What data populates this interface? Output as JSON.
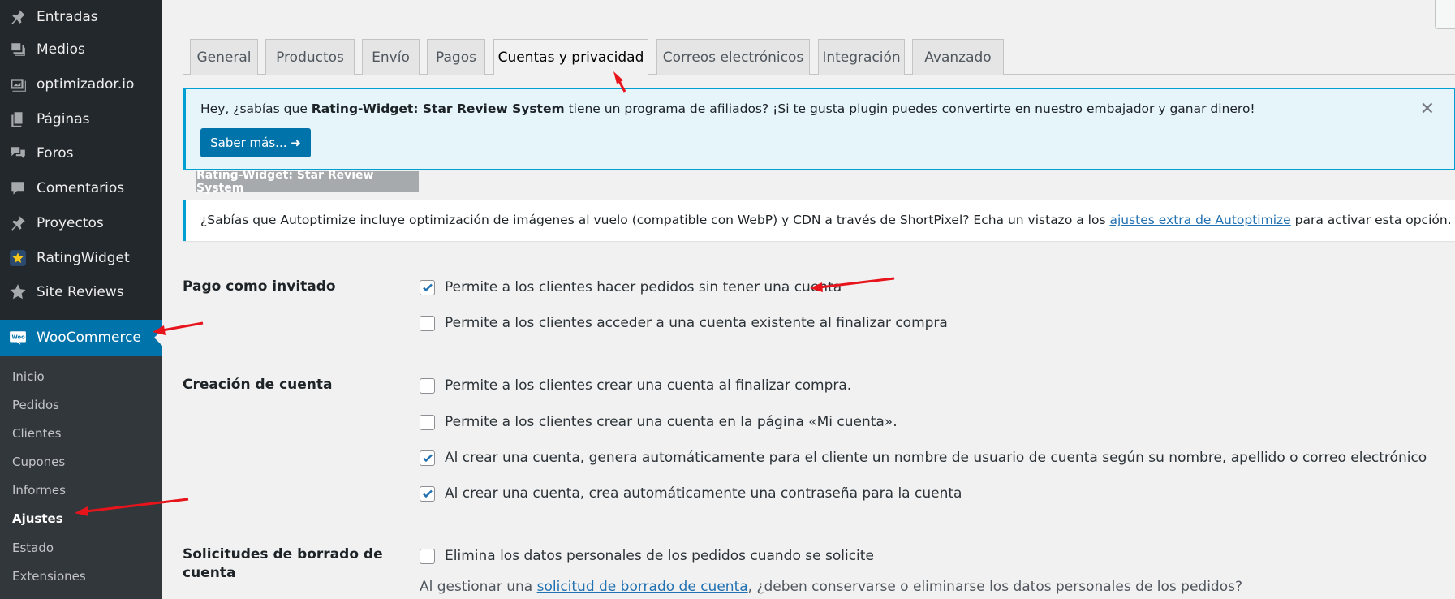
{
  "sidebar": {
    "items": [
      {
        "label": "Entradas",
        "icon": "pin-icon"
      },
      {
        "label": "Medios",
        "icon": "media-icon"
      },
      {
        "label": "optimizador.io",
        "icon": "optimizer-icon"
      },
      {
        "label": "Páginas",
        "icon": "pages-icon"
      },
      {
        "label": "Foros",
        "icon": "forums-icon"
      },
      {
        "label": "Comentarios",
        "icon": "comments-icon"
      },
      {
        "label": "Proyectos",
        "icon": "pin-icon"
      },
      {
        "label": "RatingWidget",
        "icon": "ratingwidget-icon"
      },
      {
        "label": "Site Reviews",
        "icon": "star-icon"
      }
    ],
    "woocommerce": {
      "label": "WooCommerce",
      "icon": "woo-icon"
    },
    "submenu": [
      "Inicio",
      "Pedidos",
      "Clientes",
      "Cupones",
      "Informes",
      "Ajustes",
      "Estado",
      "Extensiones"
    ],
    "submenu_current": "Ajustes"
  },
  "tabs": [
    "General",
    "Productos",
    "Envío",
    "Pagos",
    "Cuentas y privacidad",
    "Correos electrónicos",
    "Integración",
    "Avanzado"
  ],
  "active_tab": "Cuentas y privacidad",
  "affiliate_notice": {
    "text_before": "Hey, ¿sabías que ",
    "plugin_name": "Rating-Widget: Star Review System",
    "text_after": " tiene un programa de afiliados? ¡Si te gusta plugin puedes convertirte en nuestro embajador y ganar dinero!",
    "button_label": "Saber más... ➜",
    "close_label": "✕",
    "tag_label": "Rating-Widget: Star Review System"
  },
  "ao_notice": {
    "text_before": "¿Sabías que Autoptimize incluye optimización de imágenes al vuelo (compatible con WebP) y CDN a través de ShortPixel? Echa un vistazo a los ",
    "link_text": "ajustes extra de Autoptimize",
    "text_after": " para activar esta opción."
  },
  "settings": {
    "guest": {
      "label": "Pago como invitado",
      "options": [
        {
          "text": "Permite a los clientes hacer pedidos sin tener una cuenta",
          "checked": true
        },
        {
          "text": "Permite a los clientes acceder a una cuenta existente al finalizar compra",
          "checked": false
        }
      ]
    },
    "account_creation": {
      "label": "Creación de cuenta",
      "options": [
        {
          "text": "Permite a los clientes crear una cuenta al finalizar compra.",
          "checked": false
        },
        {
          "text": "Permite a los clientes crear una cuenta en la página «Mi cuenta».",
          "checked": false
        },
        {
          "text": "Al crear una cuenta, genera automáticamente para el cliente un nombre de usuario de cuenta según su nombre, apellido o correo electrónico",
          "checked": true
        },
        {
          "text": "Al crear una cuenta, crea automáticamente una contraseña para la cuenta",
          "checked": true
        }
      ]
    },
    "erasure": {
      "label_line1": "Solicitudes de borrado de",
      "label_line2": "cuenta",
      "options": [
        {
          "text": "Elimina los datos personales de los pedidos cuando se solicite",
          "checked": false
        }
      ],
      "desc_before": "Al gestionar una ",
      "desc_link": "solicitud de borrado de cuenta",
      "desc_after": ", ¿deben conservarse o eliminarse los datos personales de los pedidos?"
    }
  },
  "colors": {
    "sidebar_bg": "#23282d",
    "submenu_bg": "#32373c",
    "accent": "#0073aa",
    "notice_border": "#00a0d2",
    "checkbox_check": "#2271b1",
    "annotation_arrow": "#e8141b"
  }
}
